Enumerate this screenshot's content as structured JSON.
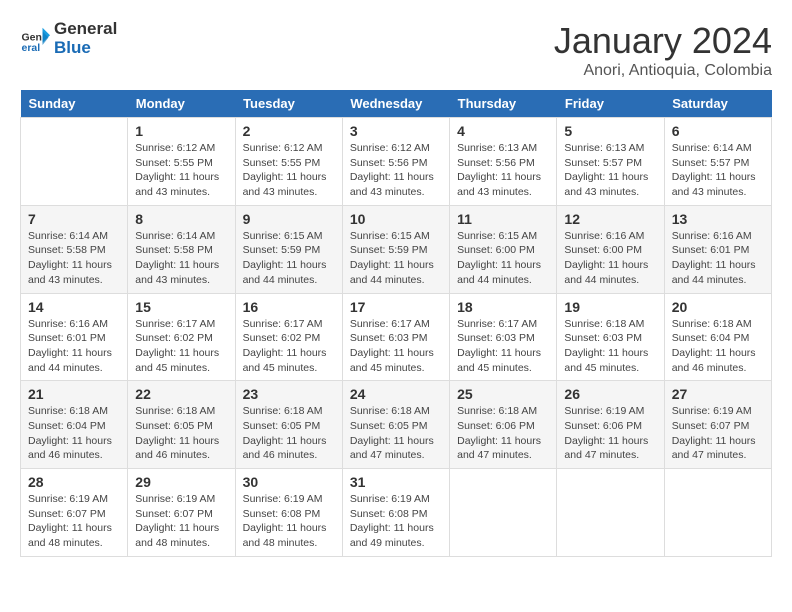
{
  "header": {
    "logo_line1": "General",
    "logo_line2": "Blue",
    "main_title": "January 2024",
    "subtitle": "Anori, Antioquia, Colombia"
  },
  "calendar": {
    "days_of_week": [
      "Sunday",
      "Monday",
      "Tuesday",
      "Wednesday",
      "Thursday",
      "Friday",
      "Saturday"
    ],
    "weeks": [
      [
        {
          "day": "",
          "info": ""
        },
        {
          "day": "1",
          "info": "Sunrise: 6:12 AM\nSunset: 5:55 PM\nDaylight: 11 hours\nand 43 minutes."
        },
        {
          "day": "2",
          "info": "Sunrise: 6:12 AM\nSunset: 5:55 PM\nDaylight: 11 hours\nand 43 minutes."
        },
        {
          "day": "3",
          "info": "Sunrise: 6:12 AM\nSunset: 5:56 PM\nDaylight: 11 hours\nand 43 minutes."
        },
        {
          "day": "4",
          "info": "Sunrise: 6:13 AM\nSunset: 5:56 PM\nDaylight: 11 hours\nand 43 minutes."
        },
        {
          "day": "5",
          "info": "Sunrise: 6:13 AM\nSunset: 5:57 PM\nDaylight: 11 hours\nand 43 minutes."
        },
        {
          "day": "6",
          "info": "Sunrise: 6:14 AM\nSunset: 5:57 PM\nDaylight: 11 hours\nand 43 minutes."
        }
      ],
      [
        {
          "day": "7",
          "info": "Sunrise: 6:14 AM\nSunset: 5:58 PM\nDaylight: 11 hours\nand 43 minutes."
        },
        {
          "day": "8",
          "info": "Sunrise: 6:14 AM\nSunset: 5:58 PM\nDaylight: 11 hours\nand 43 minutes."
        },
        {
          "day": "9",
          "info": "Sunrise: 6:15 AM\nSunset: 5:59 PM\nDaylight: 11 hours\nand 44 minutes."
        },
        {
          "day": "10",
          "info": "Sunrise: 6:15 AM\nSunset: 5:59 PM\nDaylight: 11 hours\nand 44 minutes."
        },
        {
          "day": "11",
          "info": "Sunrise: 6:15 AM\nSunset: 6:00 PM\nDaylight: 11 hours\nand 44 minutes."
        },
        {
          "day": "12",
          "info": "Sunrise: 6:16 AM\nSunset: 6:00 PM\nDaylight: 11 hours\nand 44 minutes."
        },
        {
          "day": "13",
          "info": "Sunrise: 6:16 AM\nSunset: 6:01 PM\nDaylight: 11 hours\nand 44 minutes."
        }
      ],
      [
        {
          "day": "14",
          "info": "Sunrise: 6:16 AM\nSunset: 6:01 PM\nDaylight: 11 hours\nand 44 minutes."
        },
        {
          "day": "15",
          "info": "Sunrise: 6:17 AM\nSunset: 6:02 PM\nDaylight: 11 hours\nand 45 minutes."
        },
        {
          "day": "16",
          "info": "Sunrise: 6:17 AM\nSunset: 6:02 PM\nDaylight: 11 hours\nand 45 minutes."
        },
        {
          "day": "17",
          "info": "Sunrise: 6:17 AM\nSunset: 6:03 PM\nDaylight: 11 hours\nand 45 minutes."
        },
        {
          "day": "18",
          "info": "Sunrise: 6:17 AM\nSunset: 6:03 PM\nDaylight: 11 hours\nand 45 minutes."
        },
        {
          "day": "19",
          "info": "Sunrise: 6:18 AM\nSunset: 6:03 PM\nDaylight: 11 hours\nand 45 minutes."
        },
        {
          "day": "20",
          "info": "Sunrise: 6:18 AM\nSunset: 6:04 PM\nDaylight: 11 hours\nand 46 minutes."
        }
      ],
      [
        {
          "day": "21",
          "info": "Sunrise: 6:18 AM\nSunset: 6:04 PM\nDaylight: 11 hours\nand 46 minutes."
        },
        {
          "day": "22",
          "info": "Sunrise: 6:18 AM\nSunset: 6:05 PM\nDaylight: 11 hours\nand 46 minutes."
        },
        {
          "day": "23",
          "info": "Sunrise: 6:18 AM\nSunset: 6:05 PM\nDaylight: 11 hours\nand 46 minutes."
        },
        {
          "day": "24",
          "info": "Sunrise: 6:18 AM\nSunset: 6:05 PM\nDaylight: 11 hours\nand 47 minutes."
        },
        {
          "day": "25",
          "info": "Sunrise: 6:18 AM\nSunset: 6:06 PM\nDaylight: 11 hours\nand 47 minutes."
        },
        {
          "day": "26",
          "info": "Sunrise: 6:19 AM\nSunset: 6:06 PM\nDaylight: 11 hours\nand 47 minutes."
        },
        {
          "day": "27",
          "info": "Sunrise: 6:19 AM\nSunset: 6:07 PM\nDaylight: 11 hours\nand 47 minutes."
        }
      ],
      [
        {
          "day": "28",
          "info": "Sunrise: 6:19 AM\nSunset: 6:07 PM\nDaylight: 11 hours\nand 48 minutes."
        },
        {
          "day": "29",
          "info": "Sunrise: 6:19 AM\nSunset: 6:07 PM\nDaylight: 11 hours\nand 48 minutes."
        },
        {
          "day": "30",
          "info": "Sunrise: 6:19 AM\nSunset: 6:08 PM\nDaylight: 11 hours\nand 48 minutes."
        },
        {
          "day": "31",
          "info": "Sunrise: 6:19 AM\nSunset: 6:08 PM\nDaylight: 11 hours\nand 49 minutes."
        },
        {
          "day": "",
          "info": ""
        },
        {
          "day": "",
          "info": ""
        },
        {
          "day": "",
          "info": ""
        }
      ]
    ]
  }
}
